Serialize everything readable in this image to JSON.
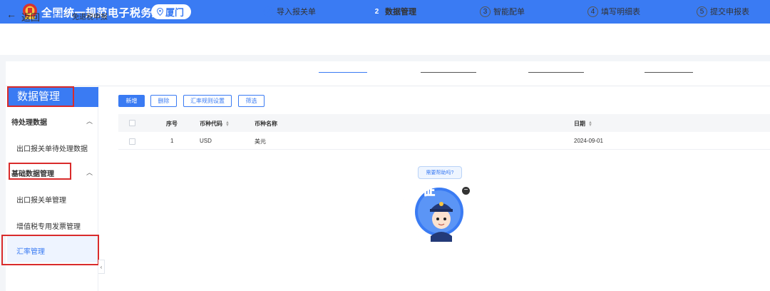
{
  "header": {
    "site_title": "全国统一规范电子税务局",
    "region": "厦门",
    "brand_color": "#3a7bf3",
    "emblem_icon": "tax-emblem-icon",
    "location_icon": "location-pin-icon"
  },
  "breadcrumb": {
    "back_label": "返回",
    "home": "首页",
    "separator": "›",
    "current": "免退税申报"
  },
  "steps": [
    {
      "index": "✓",
      "label": "导入报关单",
      "state": "done"
    },
    {
      "index": "2",
      "label": "数据管理",
      "state": "active"
    },
    {
      "index": "3",
      "label": "智能配单",
      "state": "todo"
    },
    {
      "index": "4",
      "label": "填写明细表",
      "state": "todo"
    },
    {
      "index": "5",
      "label": "提交申报表",
      "state": "todo"
    }
  ],
  "sidebar": {
    "title": "数据管理",
    "groups": [
      {
        "label": "待处理数据",
        "items": [
          "出口报关单待处理数据"
        ]
      },
      {
        "label": "基础数据管理",
        "items": [
          "出口报关单管理",
          "增值税专用发票管理",
          "汇率管理"
        ]
      }
    ],
    "selected": "汇率管理",
    "collapse_icon": "‹"
  },
  "toolbar": {
    "add": "新增",
    "delete": "删除",
    "rate_rule": "汇率规则设置",
    "filter": "筛选"
  },
  "table": {
    "columns": [
      "序号",
      "币种代码",
      "币种名称",
      "日期"
    ],
    "rows": [
      {
        "seq": "1",
        "code": "USD",
        "name": "美元",
        "date": "2024-09-01"
      }
    ]
  },
  "mascot": {
    "bubble": "需要帮助吗?",
    "chars": [
      "征",
      "纳",
      "互",
      "动"
    ],
    "close": "−"
  },
  "highlight_color": "#d92b2b"
}
